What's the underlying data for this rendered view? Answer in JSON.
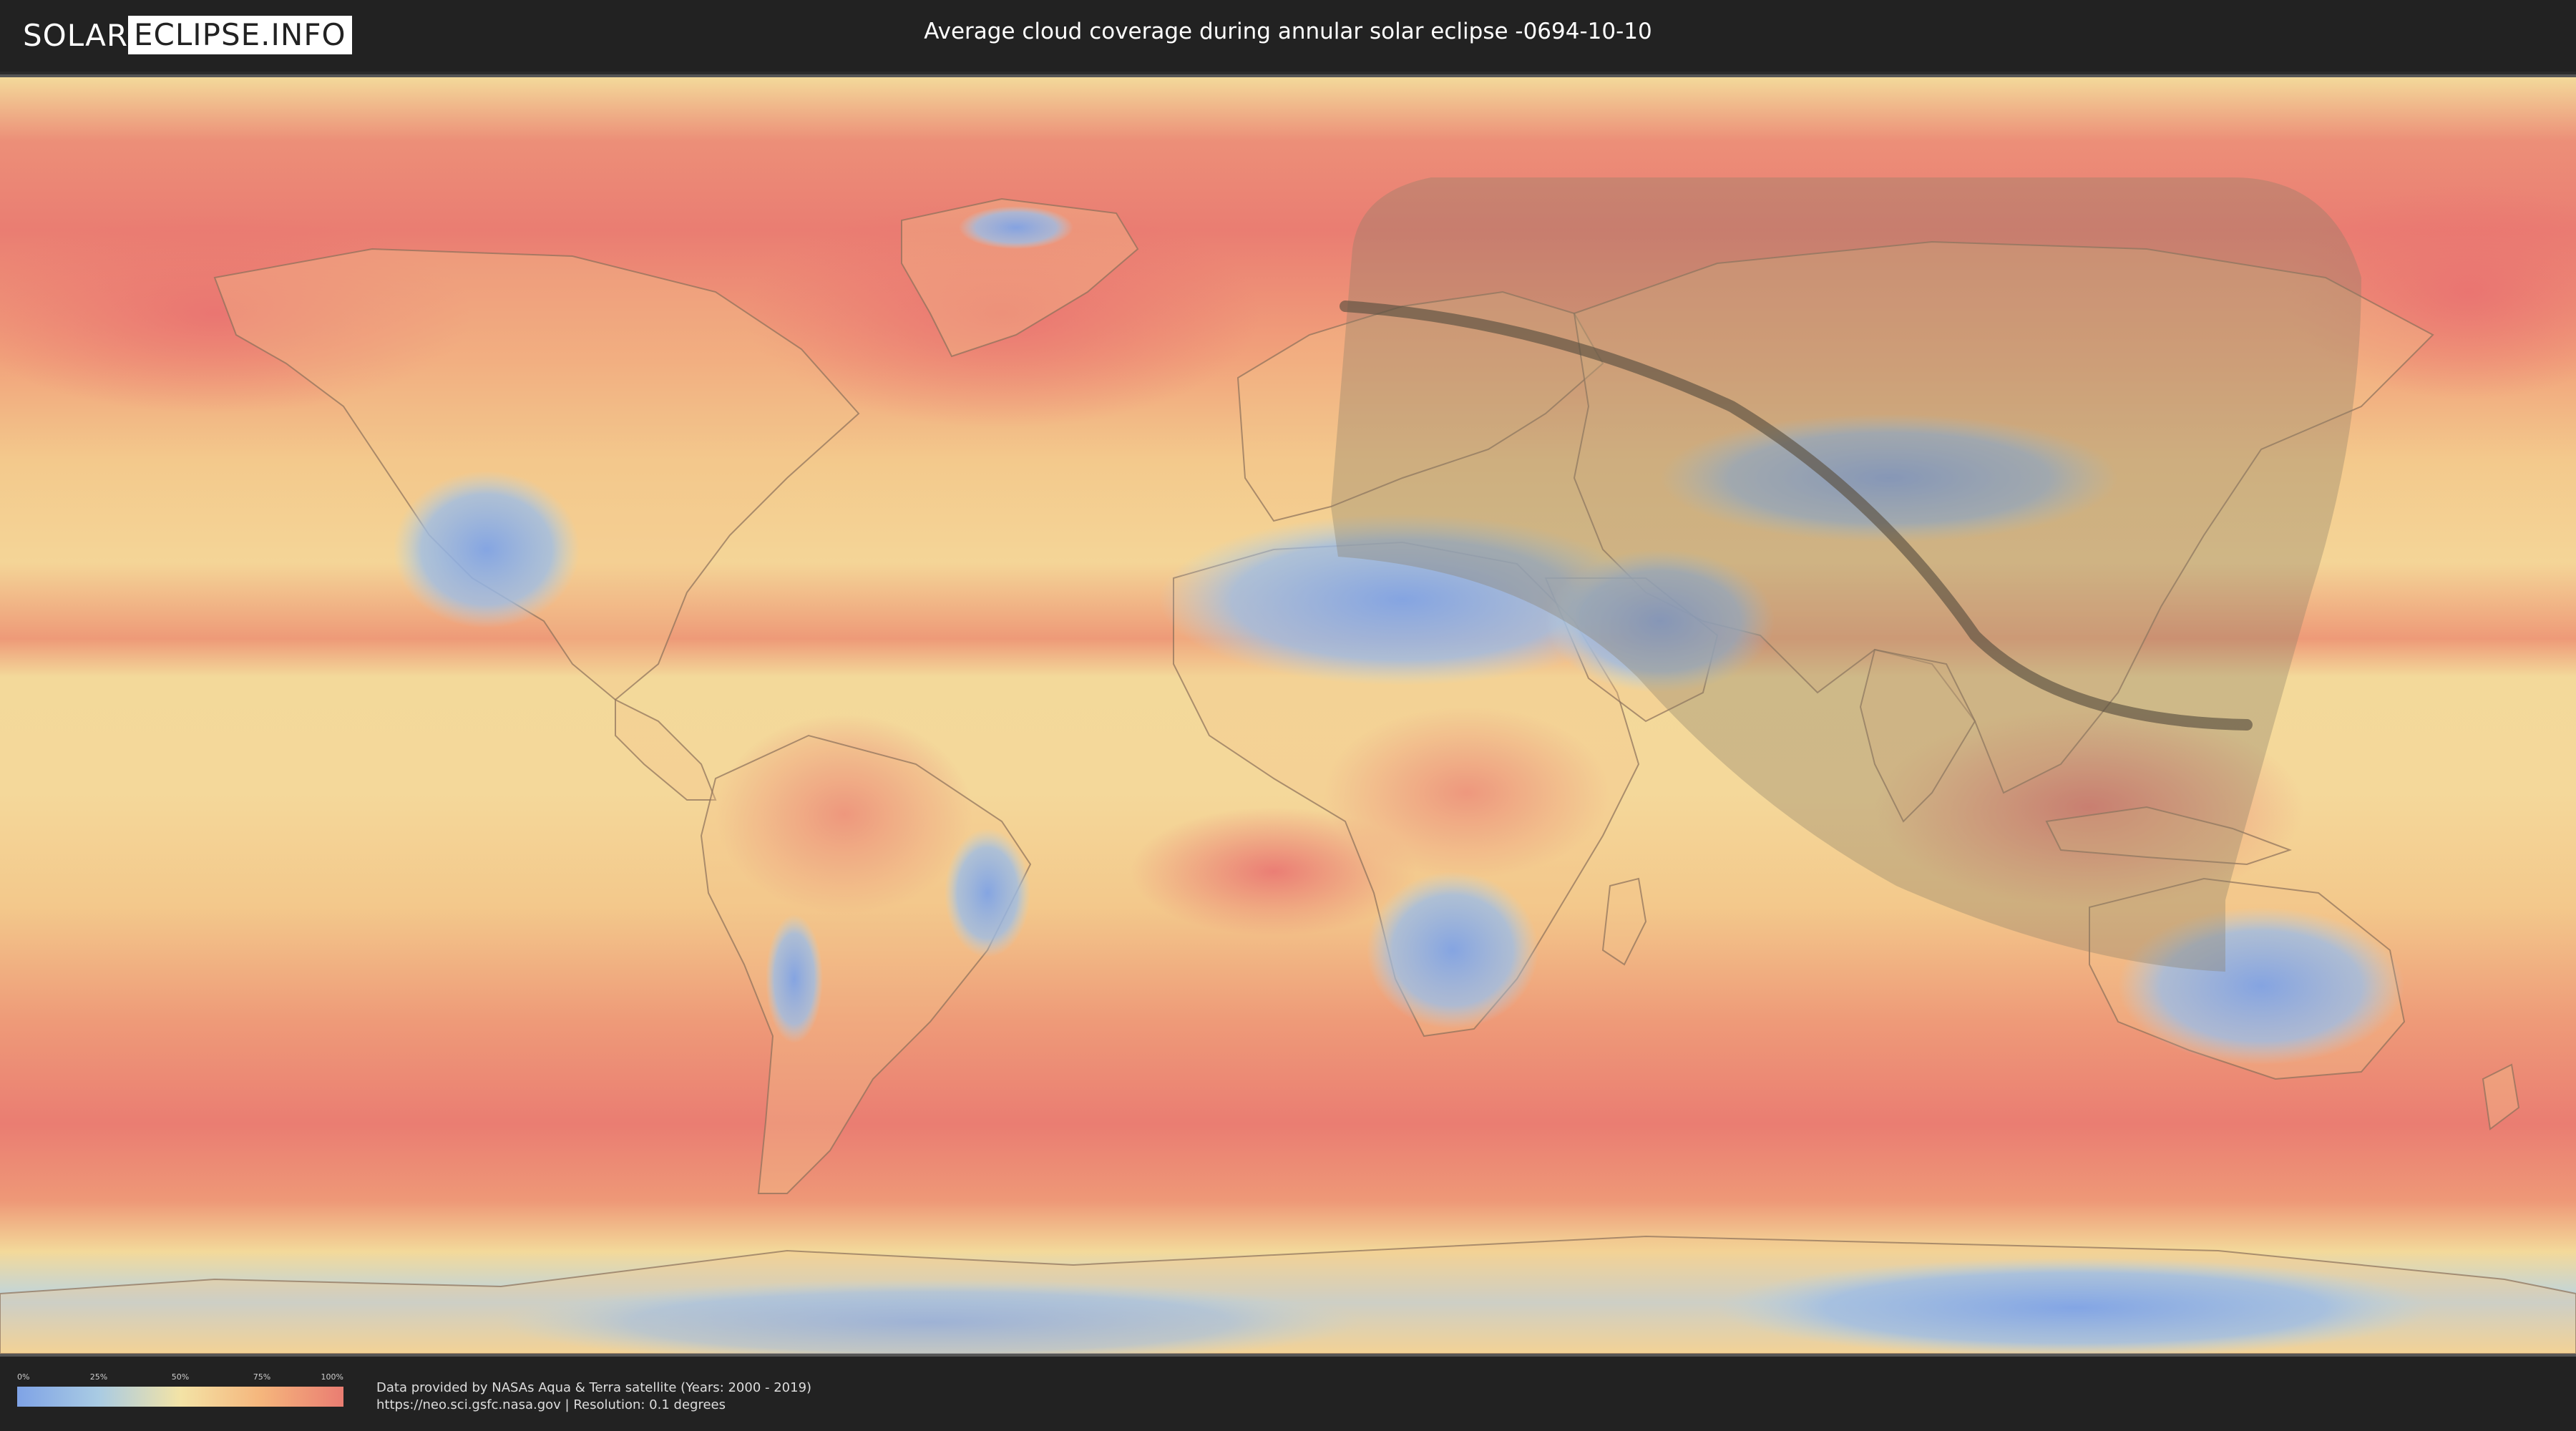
{
  "header": {
    "logo_part1": "SOLAR",
    "logo_part2": "ECLIPSE.INFO",
    "title": "Average cloud coverage during annular solar eclipse -0694-10-10"
  },
  "legend": {
    "ticks": [
      "0%",
      "25%",
      "50%",
      "75%",
      "100%"
    ],
    "colors": [
      "#7fa3e6",
      "#a9cbe3",
      "#f3e3a6",
      "#f5b57c",
      "#ea7d72"
    ]
  },
  "footer": {
    "source_line1": "Data provided by NASAs Aqua & Terra satellite (Years: 2000 - 2019)",
    "source_line2": "https://neo.sci.gsfc.nasa.gov | Resolution: 0.1 degrees"
  },
  "colors": {
    "clear": "#7fa3e6",
    "mid": "#f3d99a",
    "cloudy": "#ea7d72",
    "eclipse_overlay": "#8a7e66",
    "eclipse_path": "#5a5040"
  }
}
